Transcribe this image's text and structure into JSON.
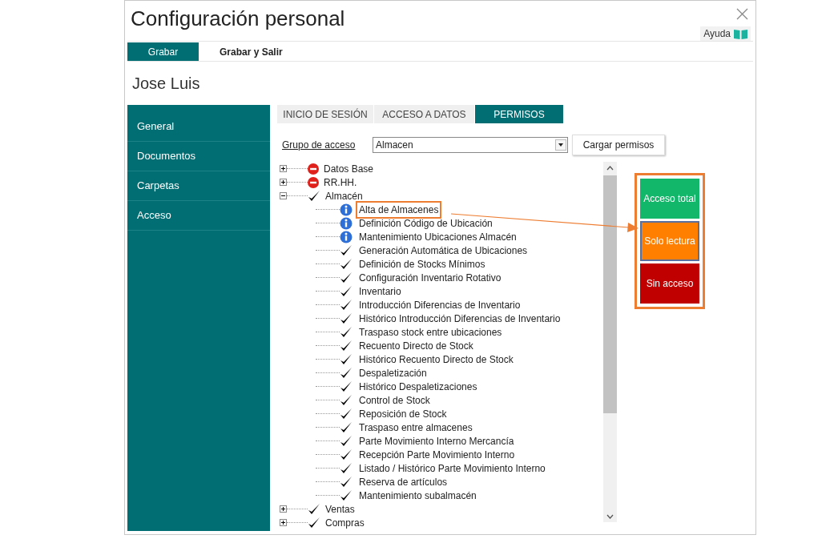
{
  "window": {
    "title": "Configuración personal",
    "help": "Ayuda"
  },
  "toolbar": [
    {
      "label": "Grabar",
      "selected": true
    },
    {
      "label": "Grabar y Salir",
      "selected": false
    }
  ],
  "user": "Jose Luis",
  "sidebar": {
    "items": [
      {
        "label": "General"
      },
      {
        "label": "Documentos"
      },
      {
        "label": "Carpetas"
      },
      {
        "label": "Acceso"
      }
    ]
  },
  "tabs": [
    {
      "label": "INICIO DE SESIÓN",
      "selected": false
    },
    {
      "label": "ACCESO A DATOS",
      "selected": false
    },
    {
      "label": "PERMISOS",
      "selected": true
    }
  ],
  "access_group": {
    "label": "Grupo de acceso",
    "value": "Almacen",
    "button": "Cargar permisos"
  },
  "tree": [
    {
      "label": "Datos Base",
      "kind": "deny",
      "expanded": false
    },
    {
      "label": "RR.HH.",
      "kind": "deny",
      "expanded": false
    },
    {
      "label": "Almacén",
      "kind": "allow",
      "expanded": true,
      "children": [
        {
          "label": "Alta de Almacenes",
          "kind": "info",
          "highlighted": true
        },
        {
          "label": "Definición Código de Ubicación",
          "kind": "info",
          "highlighted": false
        },
        {
          "label": "Mantenimiento Ubicaciones Almacén",
          "kind": "info",
          "highlighted": false
        },
        {
          "label": "Generación Automática de Ubicaciones",
          "kind": "allow",
          "highlighted": false
        },
        {
          "label": "Definición de Stocks Mínimos",
          "kind": "allow",
          "highlighted": false
        },
        {
          "label": "Configuración Inventario Rotativo",
          "kind": "allow",
          "highlighted": false
        },
        {
          "label": "Inventario",
          "kind": "allow",
          "highlighted": false
        },
        {
          "label": "Introducción Diferencias de Inventario",
          "kind": "allow",
          "highlighted": false
        },
        {
          "label": "Histórico Introducción Diferencias de Inventario",
          "kind": "allow",
          "highlighted": false
        },
        {
          "label": "Traspaso stock entre ubicaciones",
          "kind": "allow",
          "highlighted": false
        },
        {
          "label": "Recuento Directo de Stock",
          "kind": "allow",
          "highlighted": false
        },
        {
          "label": "Histórico Recuento Directo de Stock",
          "kind": "allow",
          "highlighted": false
        },
        {
          "label": "Despaletización",
          "kind": "allow",
          "highlighted": false
        },
        {
          "label": "Histórico Despaletizaciones",
          "kind": "allow",
          "highlighted": false
        },
        {
          "label": "Control de Stock",
          "kind": "allow",
          "highlighted": false
        },
        {
          "label": "Reposición de Stock",
          "kind": "allow",
          "highlighted": false
        },
        {
          "label": "Traspaso entre almacenes",
          "kind": "allow",
          "highlighted": false
        },
        {
          "label": "Parte Movimiento Interno Mercancía",
          "kind": "allow",
          "highlighted": false
        },
        {
          "label": "Recepción Parte Movimiento Interno",
          "kind": "allow",
          "highlighted": false
        },
        {
          "label": "Listado / Histórico Parte Movimiento Interno",
          "kind": "allow",
          "highlighted": false
        },
        {
          "label": "Reserva de artículos",
          "kind": "allow",
          "highlighted": false
        },
        {
          "label": "Mantenimiento subalmacén",
          "kind": "allow",
          "highlighted": false
        }
      ]
    },
    {
      "label": "Ventas",
      "kind": "allow",
      "expanded": false
    },
    {
      "label": "Compras",
      "kind": "allow",
      "expanded": false
    }
  ],
  "legend": [
    {
      "label": "Acceso total",
      "color": "#12b76a",
      "selected": false
    },
    {
      "label": "Solo lectura",
      "color": "#ff8000",
      "selected": true
    },
    {
      "label": "Sin acceso",
      "color": "#c00000",
      "selected": false
    }
  ]
}
